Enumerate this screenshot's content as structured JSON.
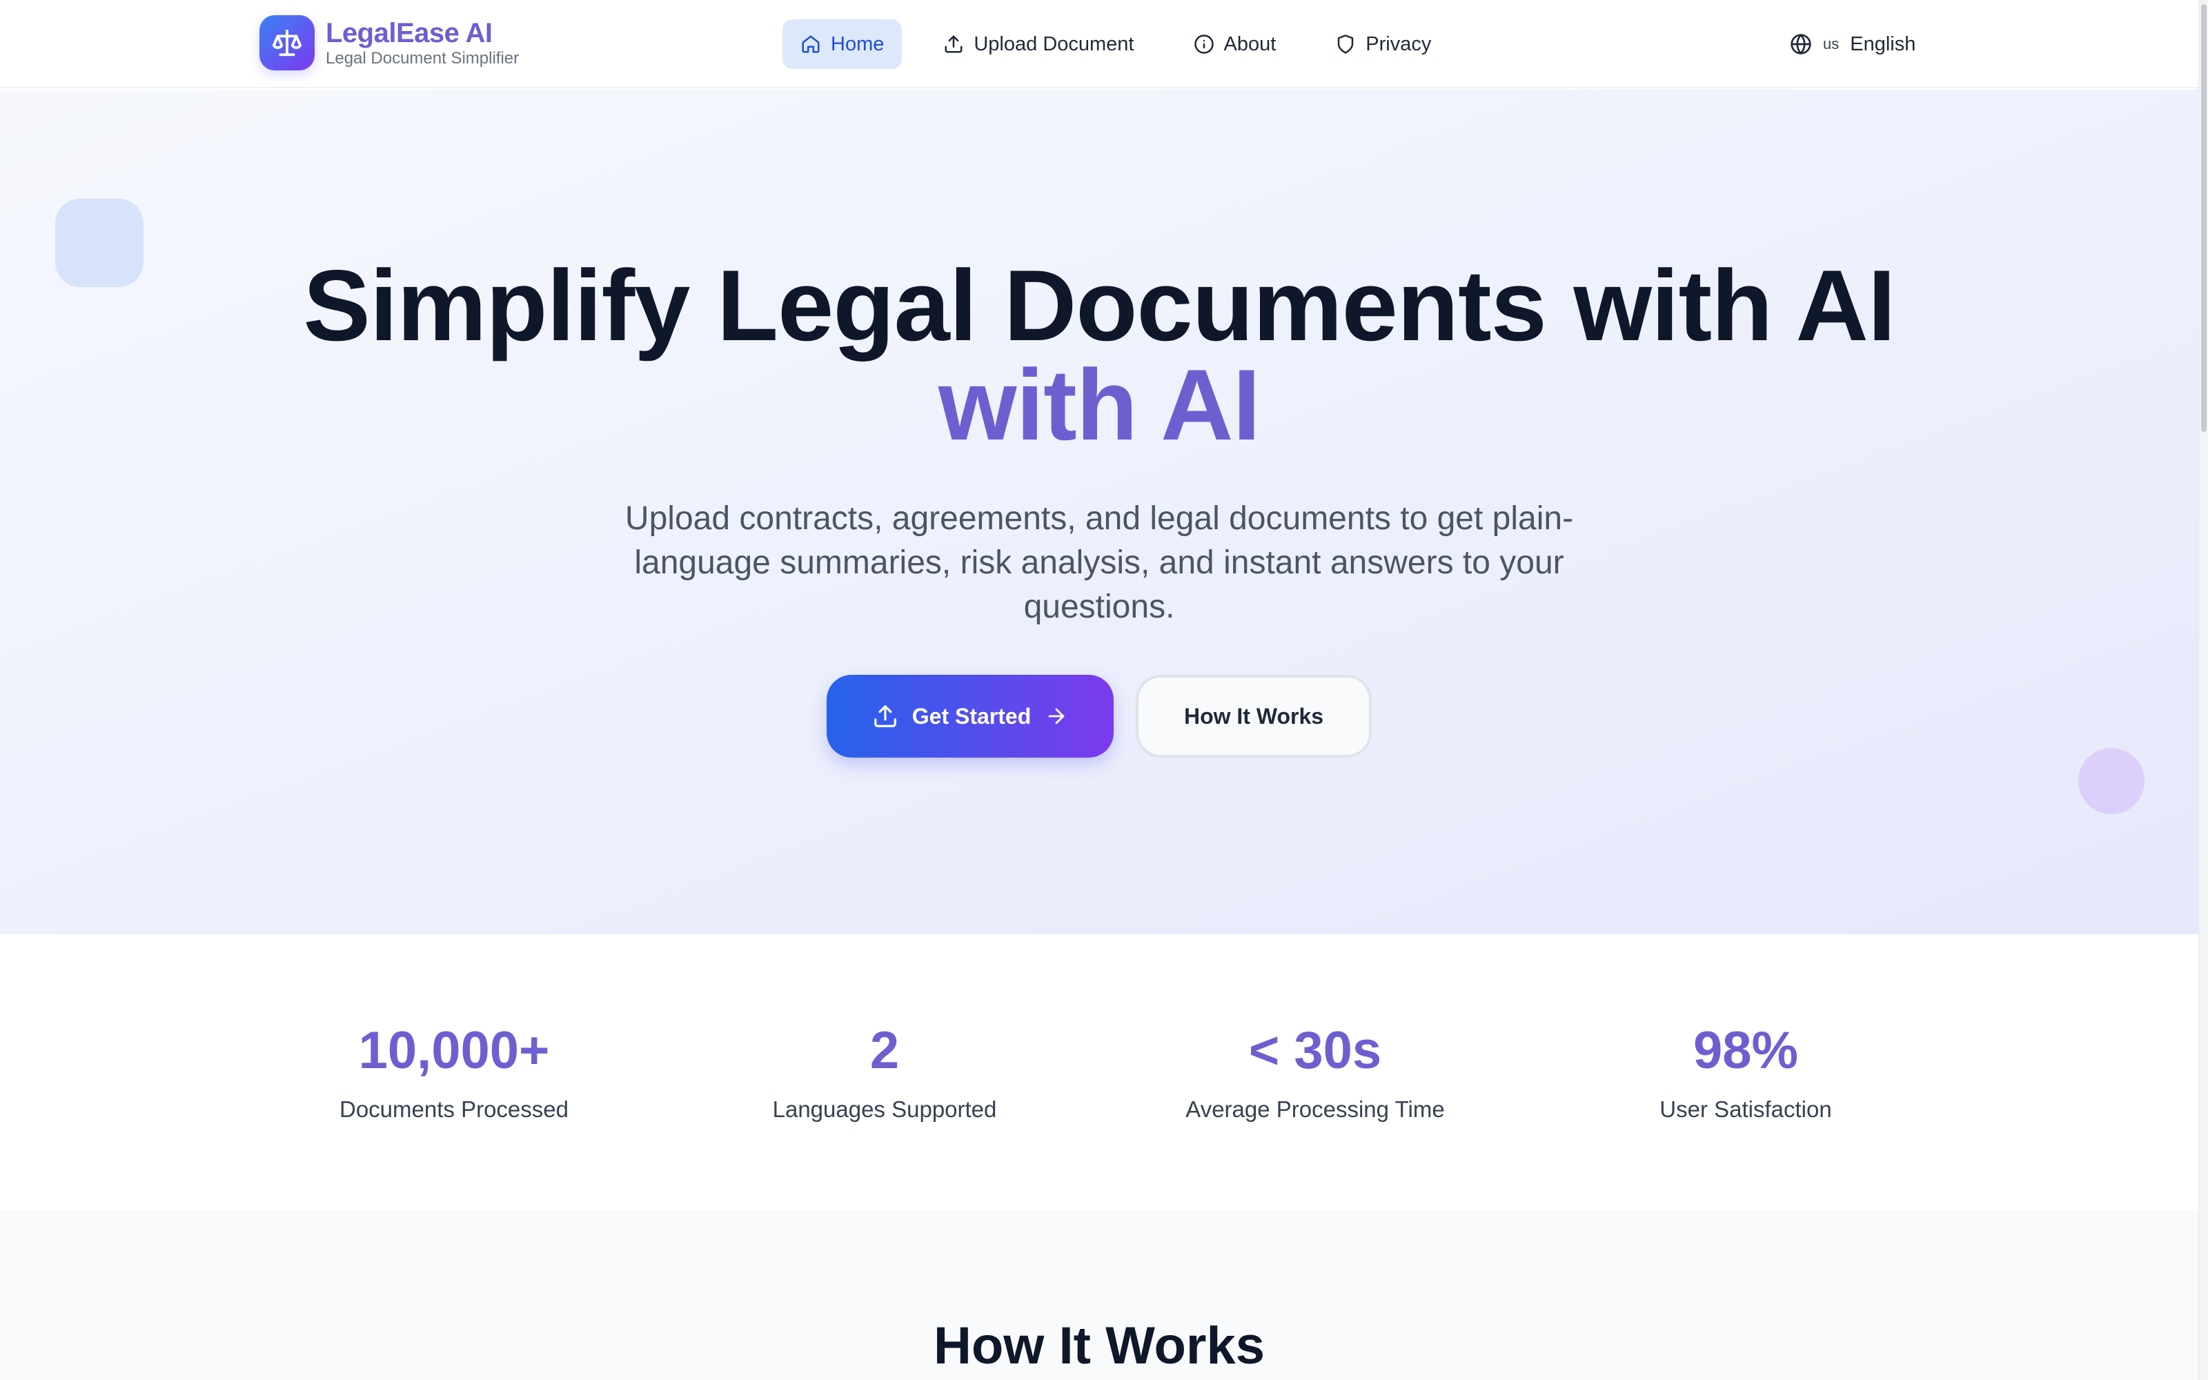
{
  "app": {
    "name": "LegalEase AI",
    "tagline": "Legal Document Simplifier"
  },
  "nav": {
    "items": [
      {
        "label": "Home",
        "icon": "home-icon",
        "active": true
      },
      {
        "label": "Upload Document",
        "icon": "upload-icon",
        "active": false
      },
      {
        "label": "About",
        "icon": "info-icon",
        "active": false
      },
      {
        "label": "Privacy",
        "icon": "shield-icon",
        "active": false
      }
    ],
    "language": {
      "flag": "us",
      "label": "English",
      "icon": "globe-icon"
    }
  },
  "hero": {
    "title": "Simplify Legal Documents with AI",
    "title_accent": "with AI",
    "subtitle": "Upload contracts, agreements, and legal documents to get plain-language summaries, risk analysis, and instant answers to your questions.",
    "primary_cta": "Get Started",
    "secondary_cta": "How It Works"
  },
  "stats": [
    {
      "value": "10,000+",
      "label": "Documents Processed"
    },
    {
      "value": "2",
      "label": "Languages Supported"
    },
    {
      "value": "< 30s",
      "label": "Average Processing Time"
    },
    {
      "value": "98%",
      "label": "User Satisfaction"
    }
  ],
  "how_it_works": {
    "title": "How It Works"
  },
  "colors": {
    "brand": "#6d5fd0",
    "primary_gradient_start": "#2563eb",
    "primary_gradient_end": "#7c3aed",
    "nav_active_bg": "#dde8fb",
    "nav_active_text": "#1d4ed8",
    "heading": "#0f172a"
  }
}
